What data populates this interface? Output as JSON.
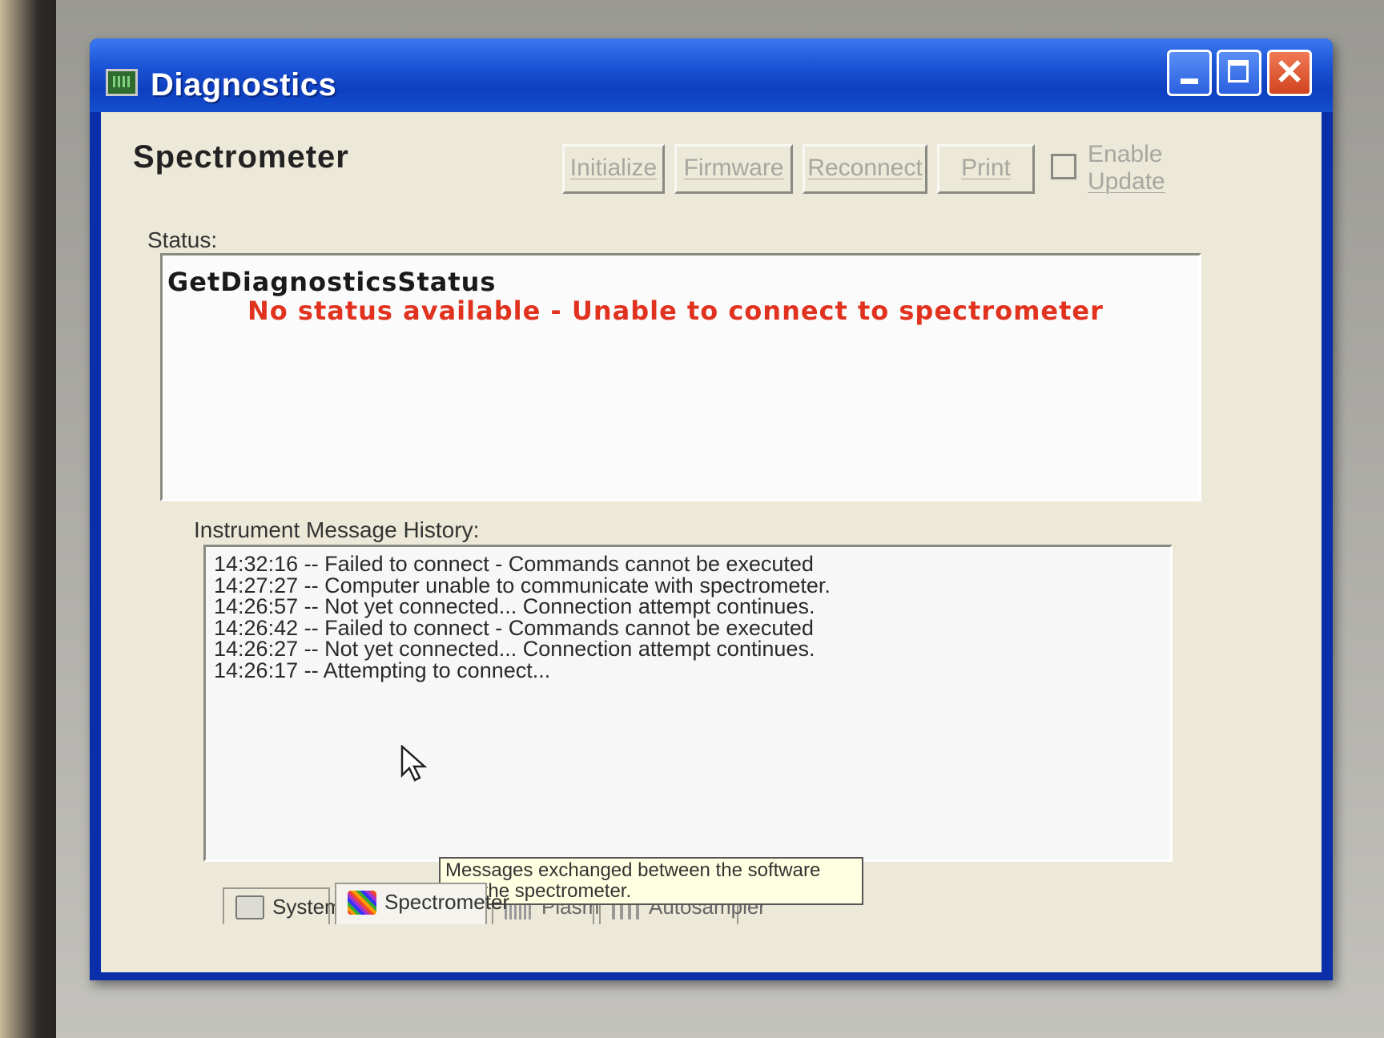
{
  "window": {
    "title": "Diagnostics"
  },
  "panel": {
    "group_title": "Spectrometer",
    "buttons": {
      "initialize": "Initialize",
      "firmware": "Firmware",
      "reconnect": "Reconnect",
      "print": "Print"
    },
    "enable_update": {
      "line1": "Enable",
      "line2": "Update",
      "checked": false
    }
  },
  "status": {
    "label": "Status:",
    "line1": "GetDiagnosticsStatus",
    "line2": "No status available - Unable to connect to spectrometer",
    "line2_color": "#e0321e"
  },
  "history": {
    "label": "Instrument Message History:",
    "messages": [
      "14:32:16 -- Failed to connect - Commands cannot be executed",
      "14:27:27 -- Computer unable to communicate with spectrometer.",
      "14:26:57 -- Not yet connected... Connection attempt continues.",
      "14:26:42 -- Failed to connect - Commands cannot be executed",
      "14:26:27 -- Not yet connected... Connection attempt continues.",
      "14:26:17 -- Attempting to connect..."
    ]
  },
  "tooltip": {
    "text": "Messages exchanged between the software and the spectrometer."
  },
  "tabs": [
    {
      "label": "System",
      "icon": "system-icon"
    },
    {
      "label": "Spectrometer",
      "icon": "spectrometer-icon",
      "active": true
    },
    {
      "label": "Plasma",
      "icon": "plasma-icon"
    },
    {
      "label": "Autosampler",
      "icon": "autosampler-icon"
    }
  ]
}
